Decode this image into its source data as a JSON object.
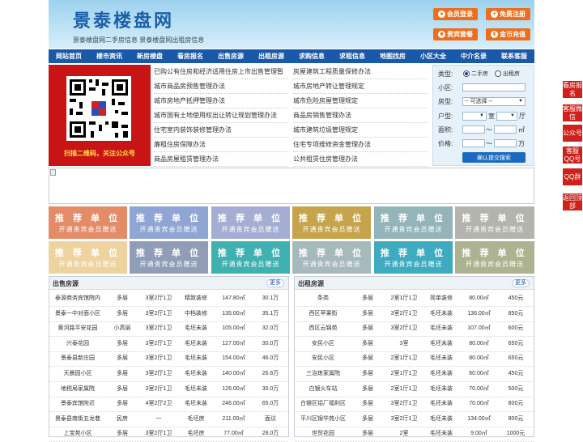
{
  "header": {
    "logo": "景泰楼盘网",
    "subtitle": "景泰楼盘网二手房信息    景泰楼盘网出租房信息",
    "buttons": [
      {
        "icon": "user-icon",
        "label": "会员登录"
      },
      {
        "icon": "user-add-icon",
        "label": "免费注册"
      },
      {
        "icon": "package-icon",
        "label": "贵宾套餐"
      },
      {
        "icon": "coin-icon",
        "label": "金币充值"
      }
    ]
  },
  "nav": [
    "网站首页",
    "楼市资讯",
    "新房楼盘",
    "看房报名",
    "出售房源",
    "出租房源",
    "求购信息",
    "求租信息",
    "地图找房",
    "小区大全",
    "中介名录",
    "联系客服"
  ],
  "qr": {
    "caption": "扫描二维码，关注公众号"
  },
  "regulations": {
    "left": [
      "已购公有住房和经济适用住房上市出售管理暂",
      "城市商品房预售管理办法",
      "城市房地产抵押管理办法",
      "城市国有土地使用权出让转让规划管理办法",
      "住宅室内装饰装修管理办法",
      "廉租住房保障办法",
      "商品房屋租赁管理办法"
    ],
    "right": [
      "房屋建筑工程质量保修办法",
      "城市房地产转让管理规定",
      "城市危险房屋管理规定",
      "商品房销售管理办法",
      "城市建筑垃圾管理规定",
      "住宅专项维修资金管理办法",
      "公共租赁住房管理办法"
    ]
  },
  "search": {
    "type_label": "类型:",
    "type_options": [
      "二手房",
      "出租房"
    ],
    "community_label": "小区:",
    "house_type_label": "房型:",
    "house_type_value": "-- 可选择 --",
    "layout_label": "户型:",
    "room_unit": "室",
    "hall_unit": "厅",
    "area_label": "面积:",
    "range_sep": "〜",
    "area_unit": "㎡",
    "price_label": "价格:",
    "price_unit": "万",
    "submit": "确认提交搜索"
  },
  "promo_tiles": {
    "title": "推 荐 单 位",
    "subtitle": "开通贵宾会员赠送",
    "colors": [
      "#e48b68",
      "#8fa5d4",
      "#a3aed2",
      "#c6a44b",
      "#93b4b8",
      "#b4b4ae",
      "#eed39f",
      "#8f9eb6",
      "#3fb1b0",
      "#a6b9bd",
      "#3eabc0",
      "#adb391"
    ]
  },
  "sale": {
    "title": "出售房源",
    "more": "更多",
    "rows": [
      [
        "泰源商务宾馆院内",
        "多层",
        "3室2厅1卫",
        "精致装修",
        "147.80㎡",
        "30.1万"
      ],
      [
        "景泰一中对面小区",
        "多层",
        "3室2厅1卫",
        "中档装修",
        "135.00㎡",
        "35.1万"
      ],
      [
        "黄河路平安花园",
        "小高层",
        "3室2厅1卫",
        "毛坯未装",
        "105.00㎡",
        "32.0万"
      ],
      [
        "兴泰花园",
        "多层",
        "3室2厅1卫",
        "毛坯未装",
        "127.00㎡",
        "30.0万"
      ],
      [
        "景泰县新庄园",
        "多层",
        "3室2厅1卫",
        "毛坯未装",
        "154.00㎡",
        "46.0万"
      ],
      [
        "天晨园小区",
        "多层",
        "3室2厅1卫",
        "毛坯未装",
        "140.00㎡",
        "26.6万"
      ],
      [
        "地税局家属院",
        "多层",
        "3室2厅1卫",
        "毛坯未装",
        "126.00㎡",
        "30.0万"
      ],
      [
        "景泰宾馆附近",
        "多层",
        "4室2厅2卫",
        "毛坯未装",
        "246.00㎡",
        "65.0万"
      ],
      [
        "景泰县南街五龙巷",
        "民房",
        "一",
        "毛坯房",
        "211.00㎡",
        "面议"
      ],
      [
        "上宝苑小区",
        "多层",
        "3室2厅1卫",
        "毛坯房",
        "77.00㎡",
        "28.0万"
      ]
    ]
  },
  "rent": {
    "title": "出租房源",
    "more": "更多",
    "rows": [
      [
        "条类",
        "多层",
        "2室1厅1卫",
        "简单装修",
        "80.00㎡",
        "450元"
      ],
      [
        "西区苹果街",
        "多层",
        "3室2厅1卫",
        "毛坯未装",
        "136.00㎡",
        "850元"
      ],
      [
        "西区云锦苑",
        "多层",
        "3室2厅1卫",
        "毛坯未装",
        "107.00㎡",
        "600元"
      ],
      [
        "安民小区",
        "多层",
        "3室",
        "毛坯未装",
        "80.00㎡",
        "650元"
      ],
      [
        "安民小区",
        "多层",
        "2室1厅1卫",
        "毛坯未装",
        "80.00㎡",
        "650元"
      ],
      [
        "三治炼家属院",
        "多层",
        "2室1厅1卫",
        "毛坯未装",
        "60.00㎡",
        "450元"
      ],
      [
        "白银火车站",
        "多层",
        "2室1厅1卫",
        "毛坯未装",
        "70.00㎡",
        "500元"
      ],
      [
        "白银区铝厂福利区",
        "多层",
        "3室2厅1卫",
        "毛坯未装",
        "70.00㎡",
        "800元"
      ],
      [
        "平川区锦华苑小区",
        "多层",
        "3室2厅1卫",
        "毛坯未装",
        "134.00㎡",
        "800元"
      ],
      [
        "世贸花园",
        "多层",
        "2室",
        "毛坯未装",
        "9.00㎡",
        "1000元"
      ]
    ]
  },
  "side_toolbar": [
    "看房报名",
    "客服微信",
    "公众号",
    "客服QQ号",
    "QQ群",
    "返回顶部"
  ]
}
